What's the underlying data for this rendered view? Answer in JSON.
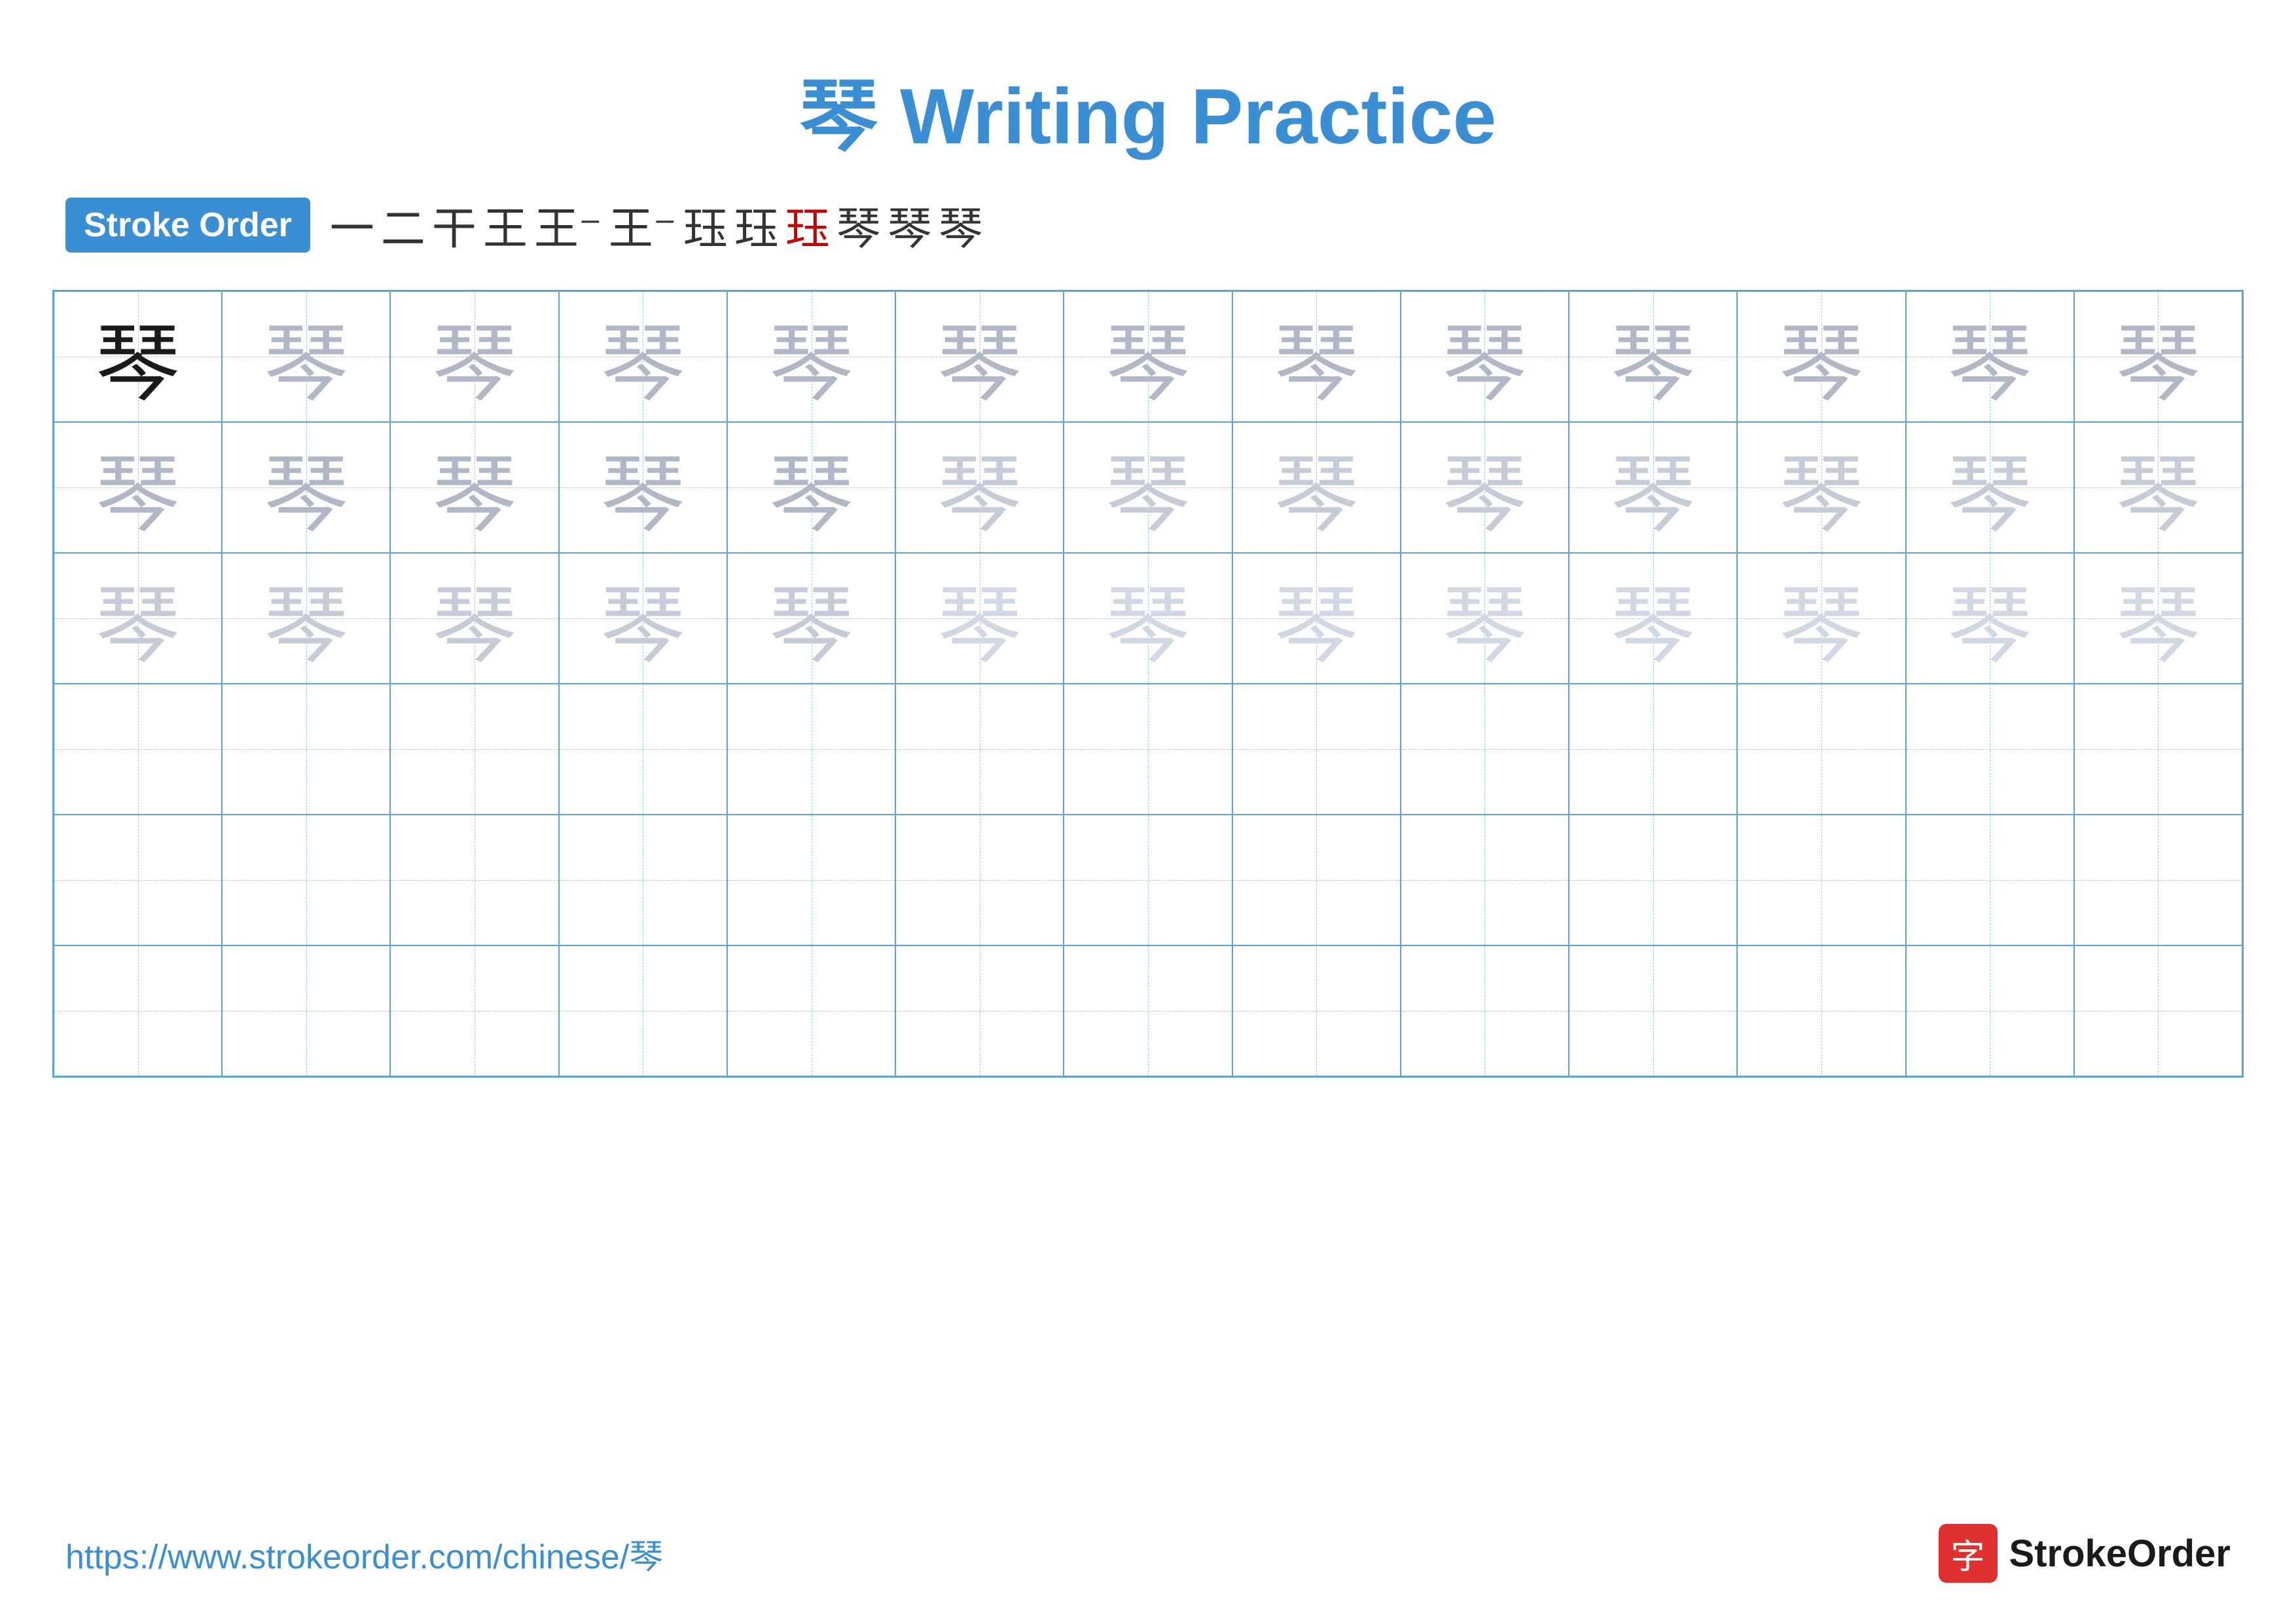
{
  "title": {
    "char": "琴",
    "text": " Writing Practice"
  },
  "stroke_order": {
    "badge_label": "Stroke Order",
    "steps": [
      "一",
      "二",
      "干",
      "王",
      "王⁻",
      "王⁻",
      "珏",
      "珏",
      "珏",
      "琴",
      "琴",
      "琴"
    ],
    "highlight_index": 8
  },
  "grid": {
    "char": "琴",
    "rows": 6,
    "cols": 13,
    "opacity_pattern": [
      [
        "dark",
        "light1",
        "light1",
        "light1",
        "light1",
        "light1",
        "light1",
        "light1",
        "light1",
        "light1",
        "light1",
        "light1",
        "light1"
      ],
      [
        "light1",
        "light1",
        "light1",
        "light1",
        "light1",
        "light2",
        "light2",
        "light2",
        "light2",
        "light2",
        "light2",
        "light2",
        "light2"
      ],
      [
        "light2",
        "light2",
        "light2",
        "light2",
        "light2",
        "light3",
        "light3",
        "light3",
        "light3",
        "light3",
        "light3",
        "light3",
        "light3"
      ],
      [
        "empty",
        "empty",
        "empty",
        "empty",
        "empty",
        "empty",
        "empty",
        "empty",
        "empty",
        "empty",
        "empty",
        "empty",
        "empty"
      ],
      [
        "empty",
        "empty",
        "empty",
        "empty",
        "empty",
        "empty",
        "empty",
        "empty",
        "empty",
        "empty",
        "empty",
        "empty",
        "empty"
      ],
      [
        "empty",
        "empty",
        "empty",
        "empty",
        "empty",
        "empty",
        "empty",
        "empty",
        "empty",
        "empty",
        "empty",
        "empty",
        "empty"
      ]
    ]
  },
  "footer": {
    "url": "https://www.strokeorder.com/chinese/琴",
    "logo_char": "字",
    "logo_name": "StrokeOrder"
  }
}
